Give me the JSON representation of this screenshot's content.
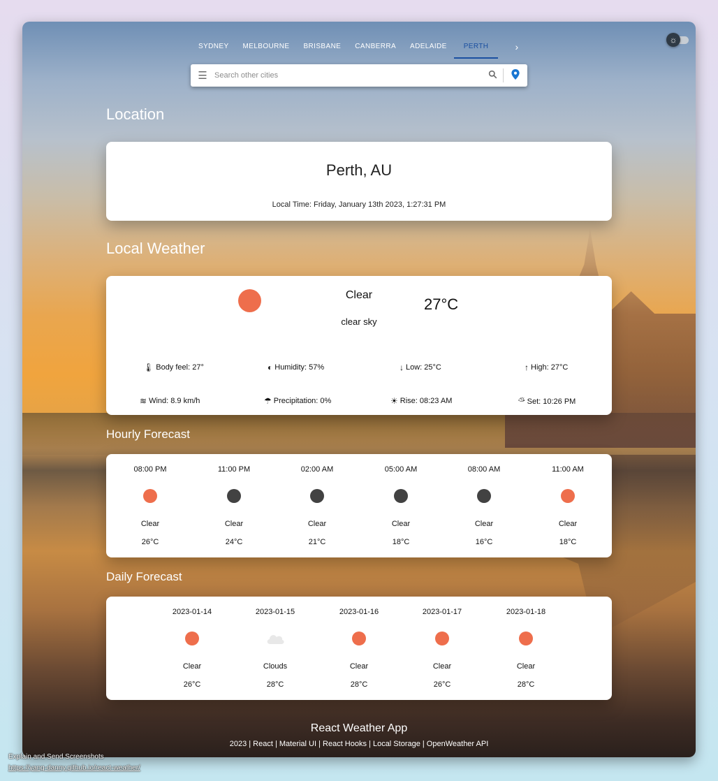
{
  "tabs": [
    "SYDNEY",
    "MELBOURNE",
    "BRISBANE",
    "CANBERRA",
    "ADELAIDE",
    "PERTH"
  ],
  "active_tab": "PERTH",
  "search": {
    "placeholder": "Search other cities"
  },
  "sections": {
    "location": "Location",
    "local_weather": "Local Weather",
    "hourly": "Hourly Forecast",
    "daily": "Daily Forecast"
  },
  "location": {
    "name": "Perth, AU",
    "local_time": "Local Time: Friday, January 13th 2023, 1:27:31 PM"
  },
  "current": {
    "main": "Clear",
    "description": "clear sky",
    "temp": "27°C",
    "icon": "sun-icon",
    "stats": {
      "body_feel": "Body feel: 27°",
      "humidity": "Humidity: 57%",
      "low": "Low: 25°C",
      "high": "High: 27°C",
      "wind": "Wind: 8.9 km/h",
      "precipitation": "Precipitation: 0%",
      "rise": "Rise: 08:23 AM",
      "set": "Set: 10:26 PM"
    }
  },
  "hourly": [
    {
      "time": "08:00 PM",
      "condition": "Clear",
      "temp": "26°C",
      "icon": "sun-icon"
    },
    {
      "time": "11:00 PM",
      "condition": "Clear",
      "temp": "24°C",
      "icon": "moon-icon"
    },
    {
      "time": "02:00 AM",
      "condition": "Clear",
      "temp": "21°C",
      "icon": "moon-icon"
    },
    {
      "time": "05:00 AM",
      "condition": "Clear",
      "temp": "18°C",
      "icon": "moon-icon"
    },
    {
      "time": "08:00 AM",
      "condition": "Clear",
      "temp": "16°C",
      "icon": "moon-icon"
    },
    {
      "time": "11:00 AM",
      "condition": "Clear",
      "temp": "18°C",
      "icon": "sun-icon"
    }
  ],
  "daily": [
    {
      "date": "2023-01-14",
      "condition": "Clear",
      "temp": "26°C",
      "icon": "sun-icon"
    },
    {
      "date": "2023-01-15",
      "condition": "Clouds",
      "temp": "28°C",
      "icon": "cloud-icon"
    },
    {
      "date": "2023-01-16",
      "condition": "Clear",
      "temp": "28°C",
      "icon": "sun-icon"
    },
    {
      "date": "2023-01-17",
      "condition": "Clear",
      "temp": "26°C",
      "icon": "sun-icon"
    },
    {
      "date": "2023-01-18",
      "condition": "Clear",
      "temp": "28°C",
      "icon": "sun-icon"
    }
  ],
  "footer": {
    "title": "React Weather App",
    "links": "2023 | React | Material UI | React Hooks | Local Storage | OpenWeather API"
  },
  "caption": {
    "line1": "Explain and Send Screenshots",
    "line2": "https://yang-danny.github.io/react-weather/"
  },
  "colors": {
    "sun": "#ee6e4c",
    "moon": "#424242",
    "cloud": "#e8e8e8",
    "active_tab": "#1a4fa0",
    "pin": "#1976d2"
  }
}
